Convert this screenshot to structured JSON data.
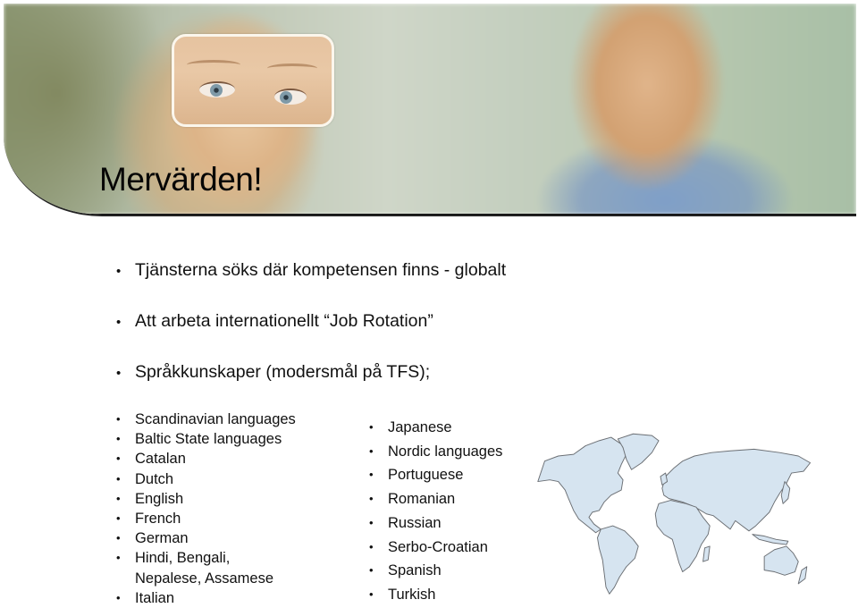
{
  "slide": {
    "title": "Mervärden!",
    "bullets": [
      "Tjänsterna söks där kompetensen finns - globalt",
      "Att arbeta internationellt “Job Rotation”",
      "Språkkunskaper (modersmål på TFS);"
    ],
    "languages_left": [
      "Scandinavian languages",
      "Baltic State languages",
      "Catalan",
      "Dutch",
      "English",
      "French",
      "German",
      "Hindi, Bengali,",
      "Italian"
    ],
    "languages_left_continuation": "Nepalese, Assamese",
    "languages_right": [
      "Japanese",
      "Nordic languages",
      "Portuguese",
      "Romanian",
      "Russian",
      "Serbo-Croatian",
      "Spanish",
      "Turkish"
    ],
    "bullet_glyph": "•"
  },
  "images": {
    "banner": "blurred-photo-woman-and-man",
    "map": "world-map"
  },
  "colors": {
    "map_fill": "#d6e4f0",
    "map_stroke": "#6b6f74",
    "eye_frame": "#fbf6ec"
  }
}
